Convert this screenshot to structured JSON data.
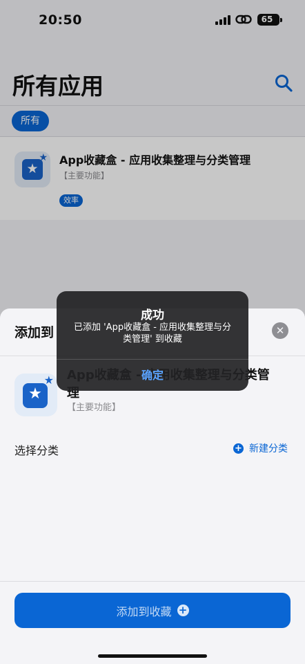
{
  "status_bar": {
    "time": "20:50",
    "battery": "65"
  },
  "header": {
    "title": "所有应用",
    "search_icon": "search-icon"
  },
  "filters": {
    "all_chip": "所有"
  },
  "apps": [
    {
      "name": "App收藏盒 - 应用收集整理与分类管理",
      "subtitle": "【主要功能】",
      "tag": "效率",
      "icon": "star-icon"
    }
  ],
  "sheet": {
    "title": "添加到",
    "close_icon": "close-icon",
    "app_name": "App收藏盒 - 应用收集整理与分类管理",
    "app_subtitle": "【主要功能】",
    "choose_category_label": "选择分类",
    "new_category_label": "新建分类",
    "add_button_label": "添加到收藏"
  },
  "alert": {
    "title": "成功",
    "message": "已添加 'App收藏盒 - 应用收集整理与分类管理' 到收藏",
    "ok_label": "确定"
  },
  "colors": {
    "accent": "#0a66d4",
    "alert_button": "#5aa3ff",
    "alert_bg": "#222224"
  }
}
